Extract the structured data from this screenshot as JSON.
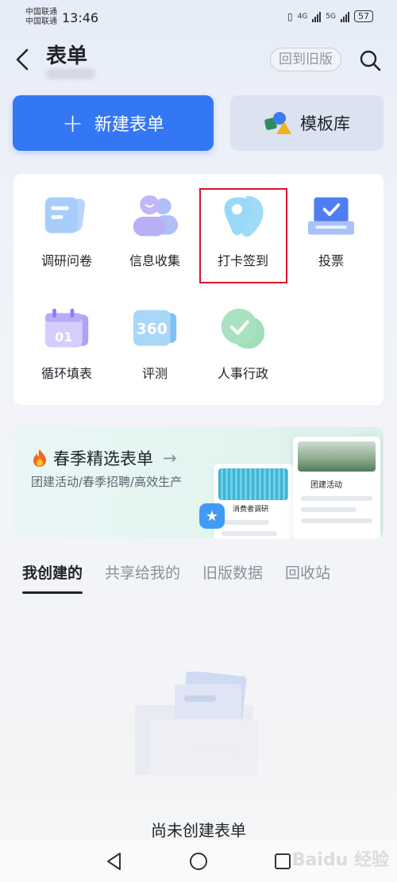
{
  "status_bar": {
    "carrier1": "中国联通",
    "carrier2": "中国联通",
    "time": "13:46",
    "net1": "4G",
    "net2": "5G",
    "battery": "57"
  },
  "header": {
    "title": "表单",
    "old_version_label": "回到旧版"
  },
  "actions": {
    "new_form_label": "新建表单",
    "template_label": "模板库"
  },
  "grid": [
    {
      "label": "调研问卷"
    },
    {
      "label": "信息收集"
    },
    {
      "label": "打卡签到"
    },
    {
      "label": "投票"
    },
    {
      "label": "循环填表",
      "icon_text": "01"
    },
    {
      "label": "评测",
      "icon_text": "360"
    },
    {
      "label": "人事行政"
    }
  ],
  "promo": {
    "title": "春季精选表单",
    "arrow": "→",
    "subtitle": "团建活动/春季招聘/高效生产",
    "card1_label": "消费者调研",
    "card2_label": "团建活动"
  },
  "tabs": [
    {
      "label": "我创建的",
      "active": true
    },
    {
      "label": "共享给我的",
      "active": false
    },
    {
      "label": "旧版数据",
      "active": false
    },
    {
      "label": "回收站",
      "active": false
    }
  ],
  "empty_state": {
    "text": "尚未创建表单"
  },
  "watermark": "Baidu 经验",
  "colors": {
    "primary": "#3477f4",
    "highlight_border": "#d8142b"
  }
}
